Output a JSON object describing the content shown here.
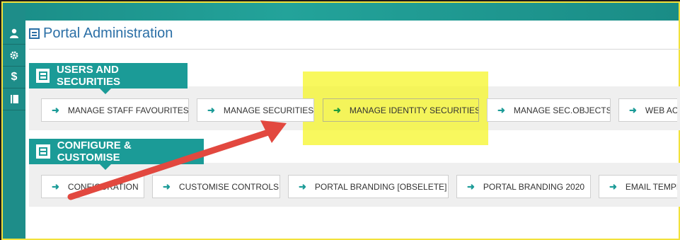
{
  "app": {
    "title": "Portal Administration"
  },
  "sidebar": {
    "items": [
      {
        "icon": "user-icon",
        "glyph": "👤"
      },
      {
        "icon": "gear-icon",
        "glyph": "⚙"
      },
      {
        "icon": "dollar-icon",
        "glyph": "$"
      },
      {
        "icon": "book-icon",
        "glyph": "📘"
      }
    ]
  },
  "sections": [
    {
      "title": "USERS AND SECURITIES",
      "tiles": [
        "MANAGE STAFF FAVOURITES",
        "MANAGE SECURITIES",
        "MANAGE IDENTITY SECURITIES",
        "MANAGE SEC.OBJECTS",
        "WEB AC"
      ]
    },
    {
      "title": "CONFIGURE & CUSTOMISE",
      "tiles": [
        "CONFIGURATION",
        "CUSTOMISE CONTROLS",
        "PORTAL BRANDING [OBSELETE]",
        "PORTAL BRANDING 2020",
        "EMAIL TEMPL"
      ]
    }
  ],
  "colors": {
    "accent": "#1b9b97",
    "title": "#2b6fa6",
    "highlight": "#f5f528",
    "annotation_arrow": "#e2483f",
    "frame_border": "#f2e23a"
  }
}
